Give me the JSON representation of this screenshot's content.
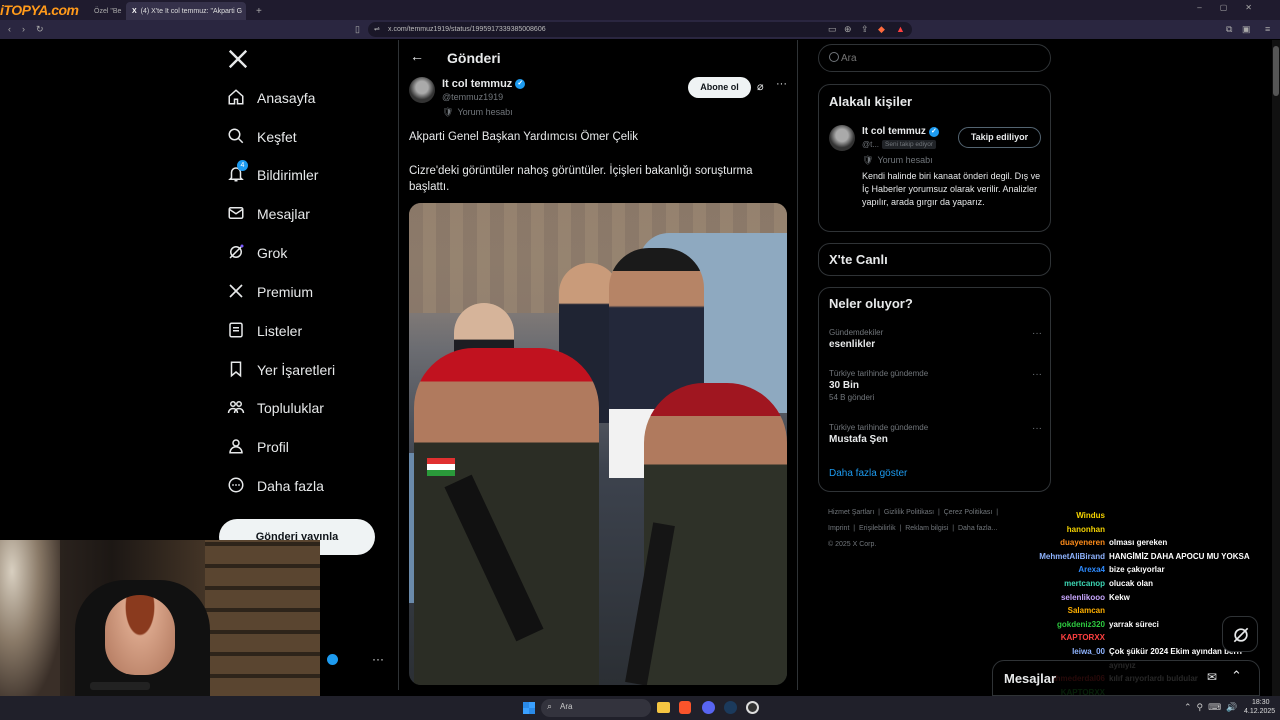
{
  "browser": {
    "tabs": [
      {
        "label": "Özel \"Be"
      },
      {
        "label": "(4) X'te It col temmuz: \"Akparti G"
      }
    ],
    "url": "x.com/temmuz1919/status/1995917339385008606",
    "logo_text": "iTOPYA.com"
  },
  "nav": {
    "items": [
      {
        "label": "Anasayfa",
        "icon": "home-icon"
      },
      {
        "label": "Keşfet",
        "icon": "search-icon"
      },
      {
        "label": "Bildirimler",
        "icon": "bell-icon",
        "badge": "4"
      },
      {
        "label": "Mesajlar",
        "icon": "mail-icon"
      },
      {
        "label": "Grok",
        "icon": "grok-icon"
      },
      {
        "label": "Premium",
        "icon": "x-logo-icon"
      },
      {
        "label": "Listeler",
        "icon": "list-icon"
      },
      {
        "label": "Yer İşaretleri",
        "icon": "bookmark-icon"
      },
      {
        "label": "Topluluklar",
        "icon": "communities-icon"
      },
      {
        "label": "Profil",
        "icon": "profile-icon"
      },
      {
        "label": "Daha fazla",
        "icon": "more-circle-icon"
      }
    ],
    "post_button": "Gönderi yayınla"
  },
  "post": {
    "header_title": "Gönderi",
    "author_name": "It col temmuz",
    "author_handle": "@temmuz1919",
    "account_note": "Yorum hesabı",
    "subscribe_label": "Abone ol",
    "text_line1": "Akparti Genel Başkan Yardımcısı Ömer Çelik",
    "text_line2": "Cizre'deki görüntüler nahoş görüntüler. İçişleri bakanlığı soruşturma başlattı."
  },
  "right": {
    "search_placeholder": "Ara",
    "related_title": "Alakalı kişiler",
    "related_name": "It col temmuz",
    "related_handle": "@t...",
    "related_badge": "Seni takip ediyor",
    "related_note": "Yorum hesabı",
    "related_follow": "Takip ediliyor",
    "related_bio": "Kendi halinde biri kanaat önderi degil. Dış ve İç Haberler yorumsuz olarak verilir. Analizler yapılır, arada gırgır da yaparız.",
    "live_title": "X'te Canlı",
    "trends_title": "Neler oluyor?",
    "trends": [
      {
        "context": "Gündemdekiler",
        "name": "esenlikler",
        "count": ""
      },
      {
        "context": "Türkiye tarihinde gündemde",
        "name": "30 Bin",
        "count": "54 B gönderi"
      },
      {
        "context": "Türkiye tarihinde gündemde",
        "name": "Mustafa Şen",
        "count": ""
      }
    ],
    "show_more": "Daha fazla göster",
    "footer_links": [
      "Hizmet Şartları",
      "Gizlilik Politikası",
      "Çerez Politikası",
      "Imprint",
      "Erişilebilirlik",
      "Reklam bilgisi",
      "Daha fazla..."
    ],
    "copyright": "© 2025 X Corp."
  },
  "chat": [
    {
      "name": "Windus",
      "msg": "",
      "color": "#f5d300"
    },
    {
      "name": "hanonhan",
      "msg": "",
      "color": "#f5d300"
    },
    {
      "name": "duayeneren",
      "msg": "olması gereken",
      "color": "#ff8c1a"
    },
    {
      "name": "MehmetAliBirand",
      "msg": "HANGİMİZ DAHA APOCU MU YOKSA",
      "color": "#8fb4ff"
    },
    {
      "name": "Arexa4",
      "msg": "bize çakıyorlar",
      "color": "#2e8bff"
    },
    {
      "name": "mertcanop",
      "msg": "olucak olan",
      "color": "#3cd6b4"
    },
    {
      "name": "selenlikooo",
      "msg": "Kekw",
      "color": "#c9a7ff"
    },
    {
      "name": "Salamcan",
      "msg": "",
      "color": "#ffb000"
    },
    {
      "name": "gokdeniz320",
      "msg": "yarrak süreci",
      "color": "#2ecc40"
    },
    {
      "name": "KAPTORXX",
      "msg": "",
      "color": "#ff4040"
    },
    {
      "name": "leiwa_00",
      "msg": "Çok şükür 2024 Ekim ayından berri",
      "color": "#8fb4ff"
    },
    {
      "name": "",
      "msg": "aynıyız",
      "color": "#ffffff"
    },
    {
      "name": "ahmederdal06",
      "msg": "kılıf arıyorlardı buldular",
      "color": "#ff4040"
    },
    {
      "name": "KAPTORXX",
      "msg": "",
      "color": "#2ecc40"
    },
    {
      "name": "enrique_fedalsi",
      "msg": "",
      "color": "#3cd6b4"
    }
  ],
  "messages_bar": {
    "label": "Mesajlar"
  },
  "taskbar": {
    "search_placeholder": "Ara",
    "time": "18:30",
    "date": "4.12.2025"
  },
  "colors": {
    "accent": "#1d9bf0",
    "bg": "#000000",
    "border": "#2f3336"
  }
}
